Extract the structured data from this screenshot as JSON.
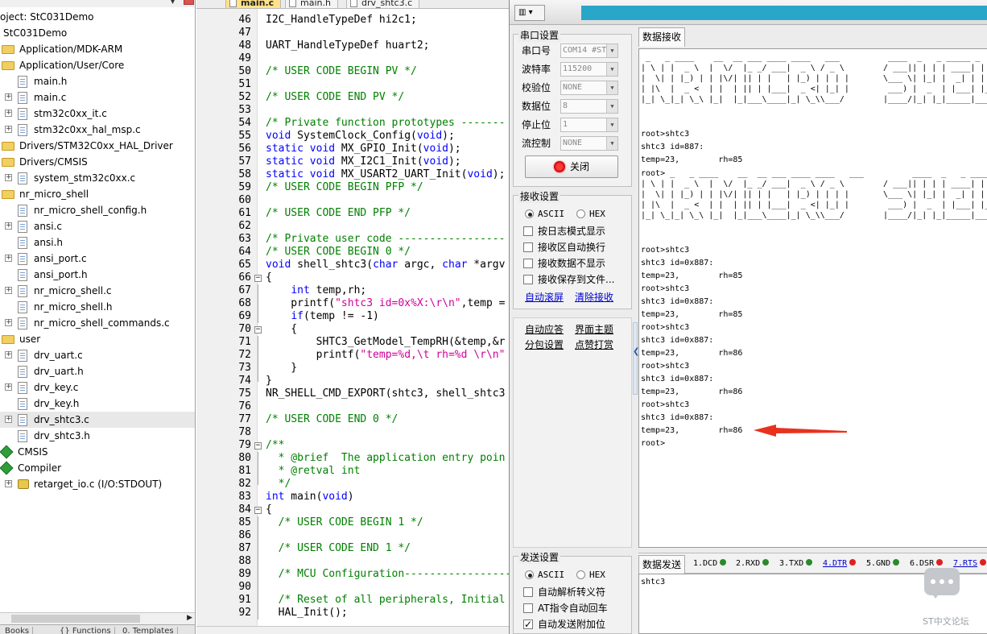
{
  "project": {
    "title": "oject: StC031Demo",
    "items": [
      {
        "label": "StC031Demo",
        "indent": 0,
        "icon": "none",
        "plus": false
      },
      {
        "label": "Application/MDK-ARM",
        "indent": 1,
        "icon": "folder",
        "plus": false
      },
      {
        "label": "Application/User/Core",
        "indent": 1,
        "icon": "folder",
        "plus": false
      },
      {
        "label": "main.h",
        "indent": 2,
        "icon": "file",
        "plus": false
      },
      {
        "label": "main.c",
        "indent": 2,
        "icon": "file",
        "plus": true
      },
      {
        "label": "stm32c0xx_it.c",
        "indent": 2,
        "icon": "file",
        "plus": true
      },
      {
        "label": "stm32c0xx_hal_msp.c",
        "indent": 2,
        "icon": "file",
        "plus": true
      },
      {
        "label": "Drivers/STM32C0xx_HAL_Driver",
        "indent": 1,
        "icon": "folder",
        "plus": false
      },
      {
        "label": "Drivers/CMSIS",
        "indent": 1,
        "icon": "folder",
        "plus": false
      },
      {
        "label": "system_stm32c0xx.c",
        "indent": 2,
        "icon": "file",
        "plus": true
      },
      {
        "label": "nr_micro_shell",
        "indent": 1,
        "icon": "folder",
        "plus": false
      },
      {
        "label": "nr_micro_shell_config.h",
        "indent": 2,
        "icon": "file",
        "plus": false
      },
      {
        "label": "ansi.c",
        "indent": 2,
        "icon": "file",
        "plus": true
      },
      {
        "label": "ansi.h",
        "indent": 2,
        "icon": "file",
        "plus": false
      },
      {
        "label": "ansi_port.c",
        "indent": 2,
        "icon": "file",
        "plus": true
      },
      {
        "label": "ansi_port.h",
        "indent": 2,
        "icon": "file",
        "plus": false
      },
      {
        "label": "nr_micro_shell.c",
        "indent": 2,
        "icon": "file",
        "plus": true
      },
      {
        "label": "nr_micro_shell.h",
        "indent": 2,
        "icon": "file",
        "plus": false
      },
      {
        "label": "nr_micro_shell_commands.c",
        "indent": 2,
        "icon": "file",
        "plus": true
      },
      {
        "label": "user",
        "indent": 1,
        "icon": "folder",
        "plus": false
      },
      {
        "label": "drv_uart.c",
        "indent": 2,
        "icon": "file",
        "plus": true
      },
      {
        "label": "drv_uart.h",
        "indent": 2,
        "icon": "file",
        "plus": false
      },
      {
        "label": "drv_key.c",
        "indent": 2,
        "icon": "file",
        "plus": true
      },
      {
        "label": "drv_key.h",
        "indent": 2,
        "icon": "file",
        "plus": false
      },
      {
        "label": "drv_shtc3.c",
        "indent": 2,
        "icon": "file",
        "plus": true,
        "selected": true
      },
      {
        "label": "drv_shtc3.h",
        "indent": 2,
        "icon": "file",
        "plus": false
      },
      {
        "label": "CMSIS",
        "indent": 1,
        "icon": "gem",
        "plus": false
      },
      {
        "label": "Compiler",
        "indent": 1,
        "icon": "gem",
        "plus": false
      },
      {
        "label": "retarget_io.c (I/O:STDOUT)",
        "indent": 2,
        "icon": "key",
        "plus": true
      }
    ],
    "bottom_tabs": [
      "Books",
      "{} Functions",
      "0. Templates"
    ]
  },
  "editor": {
    "tabs": [
      {
        "label": "main.c",
        "active": true
      },
      {
        "label": "main.h",
        "active": false
      },
      {
        "label": "drv_shtc3.c",
        "active": false
      }
    ],
    "lines": [
      {
        "n": "46",
        "fold": "",
        "code": [
          [
            "",
            "I2C_HandleTypeDef hi2c1;"
          ]
        ]
      },
      {
        "n": "47",
        "fold": "",
        "code": []
      },
      {
        "n": "48",
        "fold": "",
        "code": [
          [
            "",
            "UART_HandleTypeDef huart2;"
          ]
        ]
      },
      {
        "n": "49",
        "fold": "",
        "code": []
      },
      {
        "n": "50",
        "fold": "",
        "code": [
          [
            "c",
            "/* USER CODE BEGIN PV */"
          ]
        ]
      },
      {
        "n": "51",
        "fold": "",
        "code": []
      },
      {
        "n": "52",
        "fold": "",
        "code": [
          [
            "c",
            "/* USER CODE END PV */"
          ]
        ]
      },
      {
        "n": "53",
        "fold": "",
        "code": []
      },
      {
        "n": "54",
        "fold": "",
        "code": [
          [
            "c",
            "/* Private function prototypes -------"
          ]
        ]
      },
      {
        "n": "55",
        "fold": "",
        "code": [
          [
            "k",
            "void"
          ],
          [
            "",
            " SystemClock_Config("
          ],
          [
            "k",
            "void"
          ],
          [
            "",
            ");"
          ]
        ]
      },
      {
        "n": "56",
        "fold": "",
        "code": [
          [
            "k",
            "static void"
          ],
          [
            "",
            " MX_GPIO_Init("
          ],
          [
            "k",
            "void"
          ],
          [
            "",
            ");"
          ]
        ]
      },
      {
        "n": "57",
        "fold": "",
        "code": [
          [
            "k",
            "static void"
          ],
          [
            "",
            " MX_I2C1_Init("
          ],
          [
            "k",
            "void"
          ],
          [
            "",
            ");"
          ]
        ]
      },
      {
        "n": "58",
        "fold": "",
        "code": [
          [
            "k",
            "static void"
          ],
          [
            "",
            " MX_USART2_UART_Init("
          ],
          [
            "k",
            "void"
          ],
          [
            "",
            ");"
          ]
        ]
      },
      {
        "n": "59",
        "fold": "",
        "code": [
          [
            "c",
            "/* USER CODE BEGIN PFP */"
          ]
        ]
      },
      {
        "n": "60",
        "fold": "",
        "code": []
      },
      {
        "n": "61",
        "fold": "",
        "code": [
          [
            "c",
            "/* USER CODE END PFP */"
          ]
        ]
      },
      {
        "n": "62",
        "fold": "",
        "code": []
      },
      {
        "n": "63",
        "fold": "",
        "code": [
          [
            "c",
            "/* Private user code -----------------"
          ]
        ]
      },
      {
        "n": "64",
        "fold": "",
        "code": [
          [
            "c",
            "/* USER CODE BEGIN 0 */"
          ]
        ]
      },
      {
        "n": "65",
        "fold": "",
        "code": [
          [
            "k",
            "void"
          ],
          [
            "",
            " shell_shtc3("
          ],
          [
            "k",
            "char"
          ],
          [
            "",
            " argc, "
          ],
          [
            "k",
            "char"
          ],
          [
            "",
            " *argv"
          ]
        ]
      },
      {
        "n": "66",
        "fold": "box",
        "code": [
          [
            "",
            "{"
          ]
        ]
      },
      {
        "n": "67",
        "fold": "line",
        "code": [
          [
            "",
            "    "
          ],
          [
            "k",
            "int"
          ],
          [
            "",
            " temp,rh;"
          ]
        ]
      },
      {
        "n": "68",
        "fold": "line",
        "code": [
          [
            "",
            "    printf("
          ],
          [
            "s",
            "\"shtc3 id=0x%X:\\r\\n\""
          ],
          [
            "",
            ",temp ="
          ]
        ]
      },
      {
        "n": "69",
        "fold": "line",
        "code": [
          [
            "",
            "    "
          ],
          [
            "k",
            "if"
          ],
          [
            "",
            "(temp != -1)"
          ]
        ]
      },
      {
        "n": "70",
        "fold": "box",
        "code": [
          [
            "",
            "    {"
          ]
        ]
      },
      {
        "n": "71",
        "fold": "line",
        "code": [
          [
            "",
            "        SHTC3_GetModel_TempRH(&temp,&r"
          ]
        ]
      },
      {
        "n": "72",
        "fold": "line",
        "code": [
          [
            "",
            "        printf("
          ],
          [
            "s",
            "\"temp=%d,\\t rh=%d \\r\\n\""
          ]
        ]
      },
      {
        "n": "73",
        "fold": "line",
        "code": [
          [
            "",
            "    }"
          ]
        ]
      },
      {
        "n": "74",
        "fold": "end",
        "code": [
          [
            "",
            "}"
          ]
        ]
      },
      {
        "n": "75",
        "fold": "",
        "code": [
          [
            "",
            "NR_SHELL_CMD_EXPORT(shtc3, shell_shtc3"
          ]
        ]
      },
      {
        "n": "76",
        "fold": "",
        "code": []
      },
      {
        "n": "77",
        "fold": "",
        "code": [
          [
            "c",
            "/* USER CODE END 0 */"
          ]
        ]
      },
      {
        "n": "78",
        "fold": "",
        "code": []
      },
      {
        "n": "79",
        "fold": "box",
        "code": [
          [
            "c",
            "/**"
          ]
        ]
      },
      {
        "n": "80",
        "fold": "line",
        "code": [
          [
            "c",
            "  * @brief  The application entry poin"
          ]
        ]
      },
      {
        "n": "81",
        "fold": "line",
        "code": [
          [
            "c",
            "  * @retval int"
          ]
        ]
      },
      {
        "n": "82",
        "fold": "end",
        "code": [
          [
            "c",
            "  */"
          ]
        ]
      },
      {
        "n": "83",
        "fold": "",
        "code": [
          [
            "k",
            "int"
          ],
          [
            "",
            " main("
          ],
          [
            "k",
            "void"
          ],
          [
            "",
            ")"
          ]
        ]
      },
      {
        "n": "84",
        "fold": "box",
        "code": [
          [
            "",
            "{"
          ]
        ]
      },
      {
        "n": "85",
        "fold": "line",
        "code": [
          [
            "c",
            "  /* USER CODE BEGIN 1 */"
          ]
        ]
      },
      {
        "n": "86",
        "fold": "line",
        "code": []
      },
      {
        "n": "87",
        "fold": "line",
        "code": [
          [
            "c",
            "  /* USER CODE END 1 */"
          ]
        ]
      },
      {
        "n": "88",
        "fold": "line",
        "code": []
      },
      {
        "n": "89",
        "fold": "line",
        "code": [
          [
            "c",
            "  /* MCU Configuration-----------------"
          ]
        ]
      },
      {
        "n": "90",
        "fold": "line",
        "code": []
      },
      {
        "n": "91",
        "fold": "line",
        "code": [
          [
            "c",
            "  /* Reset of all peripherals, Initial"
          ]
        ]
      },
      {
        "n": "92",
        "fold": "line",
        "code": [
          [
            "",
            "  HAL_Init();"
          ]
        ]
      }
    ]
  },
  "serial": {
    "sys_button": "▥ ▾",
    "port_group": "串口设置",
    "fields": [
      {
        "label": "串口号",
        "value": "COM14 #STM"
      },
      {
        "label": "波特率",
        "value": "115200"
      },
      {
        "label": "校验位",
        "value": "NONE"
      },
      {
        "label": "数据位",
        "value": "8"
      },
      {
        "label": "停止位",
        "value": "1"
      },
      {
        "label": "流控制",
        "value": "NONE"
      }
    ],
    "close_button": "关闭",
    "recv_group": "接收设置",
    "recv_ascii": "ASCII",
    "recv_hex": "HEX",
    "recv_options": [
      "按日志模式显示",
      "接收区自动换行",
      "接收数据不显示",
      "接收保存到文件..."
    ],
    "auto_scroll": "自动滚屏",
    "clear_recv": "清除接收",
    "auto_reply": "自动应答",
    "ui_theme": "界面主题",
    "packet_settings": "分包设置",
    "like_checkin": "点赞打赏",
    "send_group": "发送设置",
    "send_ascii": "ASCII",
    "send_hex": "HEX",
    "send_options": [
      {
        "label": "自动解析转义符",
        "checked": false
      },
      {
        "label": "AT指令自动回车",
        "checked": false
      },
      {
        "label": "自动发送附加位",
        "checked": true
      }
    ],
    "recv_tab": "数据接收",
    "send_tab": "数据发送",
    "ascii_art": [
      " _   _ ____    __  __ ___ ____ ____   ___          ____  _   _ _____ _     _     ",
      "| \\ | |  _ \\  |  \\/  |_ _/ ___|  _ \\ / _ \\        / ___|| | | | ____| |   | |    ",
      "|  \\| | |_) | | |\\/| || | |   | |_) | | | |       \\___ \\| |_| |  _| | |   | |    ",
      "| |\\  |  _ <  | |  | || | |___|  _ <| |_| |        ___) |  _  | |___| |___| |___ ",
      "|_| \\_|_| \\_\\ |_|  |_|___\\____|_| \\_\\\\___/        |____/|_| |_|_____|_____|_____|"
    ],
    "log_a": [
      "root>shtc3",
      "shtc3 id=887:",
      "temp=23,        rh=85"
    ],
    "log_b_prefix": "root>",
    "log_c": [
      "root>shtc3",
      "shtc3 id=0x887:",
      "temp=23,        rh=85",
      "root>shtc3",
      "shtc3 id=0x887:",
      "temp=23,        rh=85",
      "root>shtc3",
      "shtc3 id=0x887:",
      "temp=23,        rh=86",
      "root>shtc3",
      "shtc3 id=0x887:",
      "temp=23,        rh=86",
      "root>shtc3",
      "shtc3 id=0x887:",
      "temp=23,        rh=86",
      "root>"
    ],
    "arrow_color": "#e8321e",
    "signals": [
      {
        "label": "1.DCD",
        "color": "#2a8a2a",
        "link": false
      },
      {
        "label": "2.RXD",
        "color": "#2a8a2a",
        "link": false
      },
      {
        "label": "3.TXD",
        "color": "#2a8a2a",
        "link": false
      },
      {
        "label": "4.DTR",
        "color": "#e02020",
        "link": true
      },
      {
        "label": "5.GND",
        "color": "#2a8a2a",
        "link": false
      },
      {
        "label": "6.DSR",
        "color": "#e02020",
        "link": false
      },
      {
        "label": "7.RTS",
        "color": "#e02020",
        "link": true
      }
    ],
    "send_text": "shtc3"
  },
  "watermark": "ST中文论坛"
}
